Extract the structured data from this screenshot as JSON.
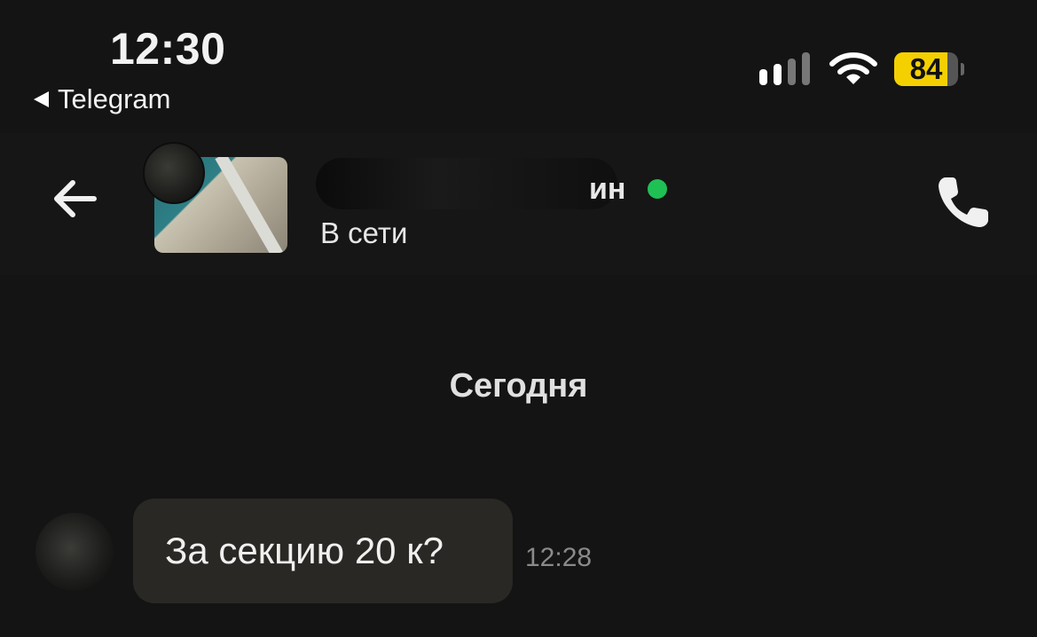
{
  "status_bar": {
    "time": "12:30",
    "back_app": "Telegram",
    "battery_level": "84",
    "battery_fraction": 0.84,
    "icons": [
      "signal-icon",
      "wifi-icon",
      "battery-icon"
    ],
    "battery_color": "#f5d000"
  },
  "header": {
    "contact_name_visible_suffix": "ин",
    "status": "В сети",
    "online_color": "#1fc155",
    "icons": [
      "back-arrow-icon",
      "phone-icon"
    ]
  },
  "chat": {
    "date_separator": "Сегодня",
    "messages": [
      {
        "text": "За секцию 20 к?",
        "time": "12:28"
      }
    ]
  }
}
